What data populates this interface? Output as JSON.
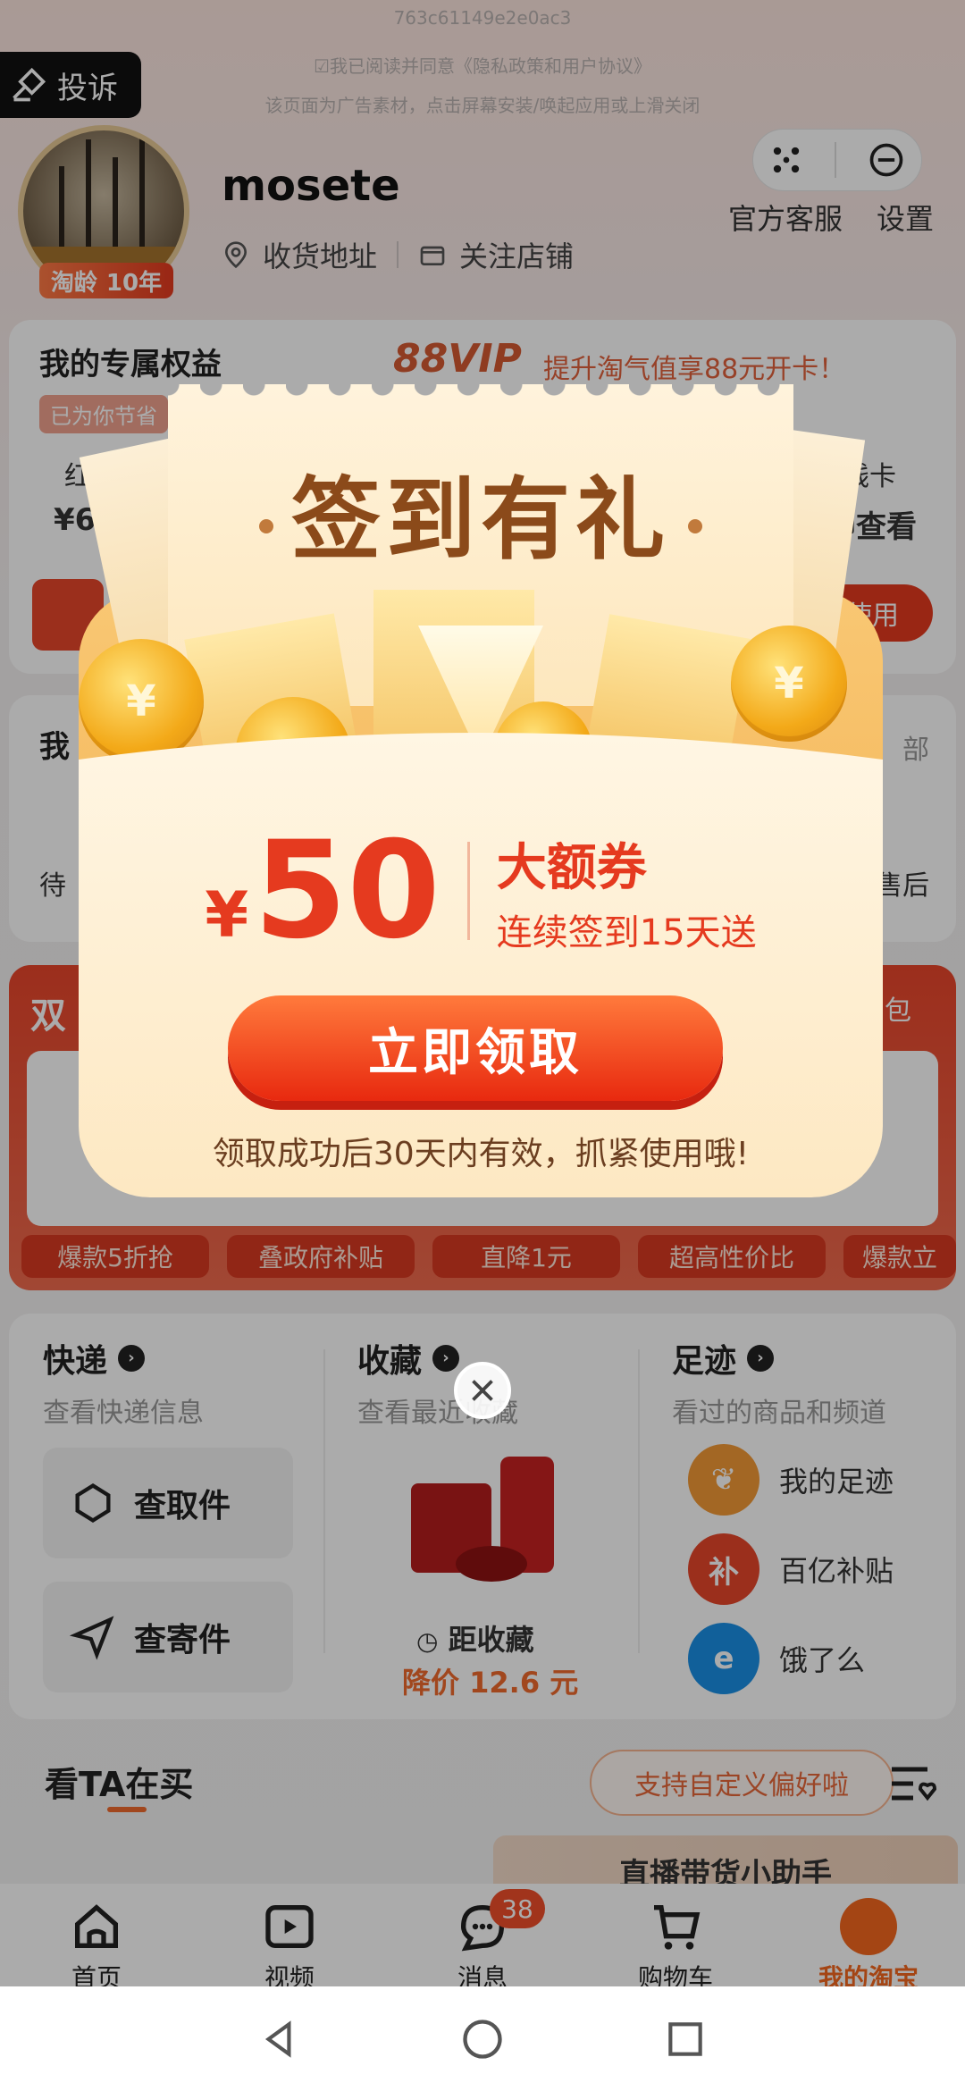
{
  "ad": {
    "code": "763c61149e2e0ac3",
    "consent": "☑我已阅读并同意《隐私政策和用户协议》",
    "notice": "该页面为广告素材，点击屏幕安装/唤起应用或上滑关闭",
    "complain_label": "投诉"
  },
  "profile": {
    "username": "mosete",
    "age_badge_prefix": "淘龄",
    "age_badge_value": "10年",
    "address_label": "收货地址",
    "follow_label": "关注店铺",
    "service_label": "官方客服",
    "settings_label": "设置"
  },
  "benefits": {
    "title": "我的专属权益",
    "saved_label": "已为你节省",
    "vip_label": "88VIP",
    "vip_message": "提升淘气值享88元开卡！",
    "col1_label": "红包",
    "col1_value": "¥62.",
    "col2_label": "省钱卡",
    "col2_value": "立即查看",
    "use_button": "去使用"
  },
  "orders": {
    "title_fragment": "我",
    "all_fragment": "部",
    "pending_fragment": "待",
    "aftersale_fragment": "售后"
  },
  "promo": {
    "title_fragment": "双",
    "more_fragment": "包",
    "labels": [
      "爆款5折抢",
      "叠政府补贴",
      "直降1元",
      "超高性价比",
      "爆款立"
    ]
  },
  "services": {
    "express_title": "快递",
    "express_sub": "查看快递信息",
    "pickup_label": "查取件",
    "send_label": "查寄件",
    "fav_title": "收藏",
    "fav_sub": "查看最近收藏",
    "fav_item_label": "距收藏",
    "fav_price": "降价 12.6 元",
    "foot_title": "足迹",
    "foot_sub": "看过的商品和频道",
    "foot_items": [
      "我的足迹",
      "百亿补贴",
      "饿了么"
    ]
  },
  "feed": {
    "title": "看TA在买",
    "pref_label": "支持自定义偏好啦",
    "live_banner": "直播带货小助手"
  },
  "tabs": [
    "首页",
    "视频",
    "消息",
    "购物车",
    "我的淘宝"
  ],
  "message_badge": "38",
  "popup": {
    "title": "签到有礼",
    "currency": "¥",
    "amount": "50",
    "coupon_title": "大额券",
    "coupon_sub": "连续签到15天送",
    "claim_button": "立即领取",
    "valid_note": "领取成功后30天内有效，抓紧使用哦!"
  },
  "colors": {
    "accent": "#E53A1F",
    "brand_orange": "#F5681E",
    "popup_gold": "#F3A918"
  }
}
